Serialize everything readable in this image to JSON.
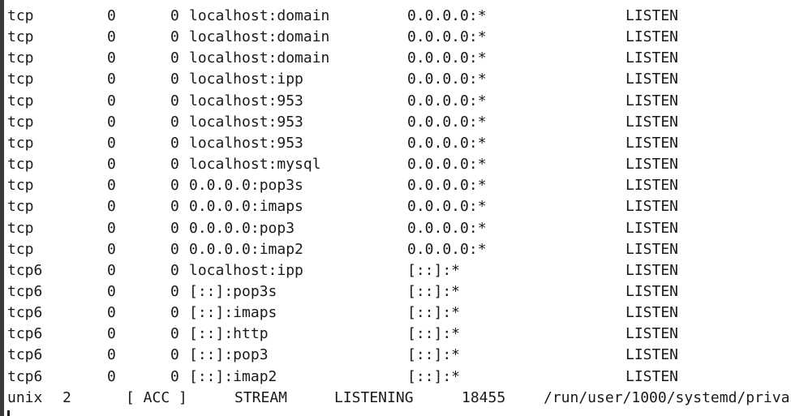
{
  "terminal": {
    "tcp_rows": [
      {
        "proto": "tcp",
        "recv_q": "0",
        "send_q": "0",
        "local": "localhost:domain",
        "foreign": "0.0.0.0:*",
        "state": "LISTEN"
      },
      {
        "proto": "tcp",
        "recv_q": "0",
        "send_q": "0",
        "local": "localhost:domain",
        "foreign": "0.0.0.0:*",
        "state": "LISTEN"
      },
      {
        "proto": "tcp",
        "recv_q": "0",
        "send_q": "0",
        "local": "localhost:domain",
        "foreign": "0.0.0.0:*",
        "state": "LISTEN"
      },
      {
        "proto": "tcp",
        "recv_q": "0",
        "send_q": "0",
        "local": "localhost:ipp",
        "foreign": "0.0.0.0:*",
        "state": "LISTEN"
      },
      {
        "proto": "tcp",
        "recv_q": "0",
        "send_q": "0",
        "local": "localhost:953",
        "foreign": "0.0.0.0:*",
        "state": "LISTEN"
      },
      {
        "proto": "tcp",
        "recv_q": "0",
        "send_q": "0",
        "local": "localhost:953",
        "foreign": "0.0.0.0:*",
        "state": "LISTEN"
      },
      {
        "proto": "tcp",
        "recv_q": "0",
        "send_q": "0",
        "local": "localhost:953",
        "foreign": "0.0.0.0:*",
        "state": "LISTEN"
      },
      {
        "proto": "tcp",
        "recv_q": "0",
        "send_q": "0",
        "local": "localhost:mysql",
        "foreign": "0.0.0.0:*",
        "state": "LISTEN"
      },
      {
        "proto": "tcp",
        "recv_q": "0",
        "send_q": "0",
        "local": "0.0.0.0:pop3s",
        "foreign": "0.0.0.0:*",
        "state": "LISTEN"
      },
      {
        "proto": "tcp",
        "recv_q": "0",
        "send_q": "0",
        "local": "0.0.0.0:imaps",
        "foreign": "0.0.0.0:*",
        "state": "LISTEN"
      },
      {
        "proto": "tcp",
        "recv_q": "0",
        "send_q": "0",
        "local": "0.0.0.0:pop3",
        "foreign": "0.0.0.0:*",
        "state": "LISTEN"
      },
      {
        "proto": "tcp",
        "recv_q": "0",
        "send_q": "0",
        "local": "0.0.0.0:imap2",
        "foreign": "0.0.0.0:*",
        "state": "LISTEN"
      },
      {
        "proto": "tcp6",
        "recv_q": "0",
        "send_q": "0",
        "local": "localhost:ipp",
        "foreign": "[::]:*",
        "state": "LISTEN"
      },
      {
        "proto": "tcp6",
        "recv_q": "0",
        "send_q": "0",
        "local": "[::]:pop3s",
        "foreign": "[::]:*",
        "state": "LISTEN"
      },
      {
        "proto": "tcp6",
        "recv_q": "0",
        "send_q": "0",
        "local": "[::]:imaps",
        "foreign": "[::]:*",
        "state": "LISTEN"
      },
      {
        "proto": "tcp6",
        "recv_q": "0",
        "send_q": "0",
        "local": "[::]:http",
        "foreign": "[::]:*",
        "state": "LISTEN"
      },
      {
        "proto": "tcp6",
        "recv_q": "0",
        "send_q": "0",
        "local": "[::]:pop3",
        "foreign": "[::]:*",
        "state": "LISTEN"
      },
      {
        "proto": "tcp6",
        "recv_q": "0",
        "send_q": "0",
        "local": "[::]:imap2",
        "foreign": "[::]:*",
        "state": "LISTEN"
      }
    ],
    "unix_row": {
      "proto": "unix",
      "refcnt": "2",
      "flags": "[ ACC ]",
      "type": "STREAM",
      "state": "LISTENING",
      "inode": "18455",
      "path": "/run/user/1000/systemd/priva"
    }
  },
  "colors": {
    "background": "#ffffff",
    "text": "#1a1a1a",
    "prompt": "#2e7d32"
  }
}
